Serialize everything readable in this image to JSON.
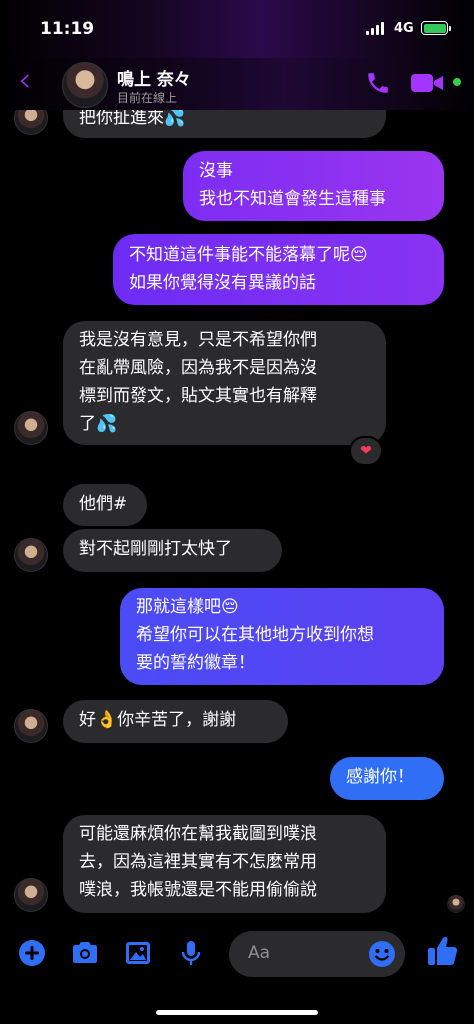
{
  "status_bar": {
    "time": "11:19",
    "network": "4G"
  },
  "header": {
    "back_icon": "‹",
    "contact_name": "鳴上 奈々",
    "presence": "目前在線上"
  },
  "colors": {
    "accent": "#a335ff",
    "in_bubble": "#2b2b2d",
    "online": "#31d14d"
  },
  "messages": [
    {
      "id": "m0",
      "dir": "in",
      "text": "把你扯進來💦"
    },
    {
      "id": "m1",
      "dir": "out",
      "text": "沒事\n我也不知道會發生這種事"
    },
    {
      "id": "m2",
      "dir": "out",
      "text": "不知道這件事能不能落幕了呢😔\n如果你覺得沒有異議的話"
    },
    {
      "id": "m3",
      "dir": "in",
      "text": "我是沒有意見，只是不希望你們\n在亂帶風險，因為我不是因為沒\n標到而發文，貼文其實也有解釋\n了💦",
      "reaction": "❤"
    },
    {
      "id": "m4",
      "dir": "in",
      "text": "他們#"
    },
    {
      "id": "m5",
      "dir": "in",
      "text": "對不起剛剛打太快了"
    },
    {
      "id": "m6",
      "dir": "out",
      "text": "那就這樣吧😔\n希望你可以在其他地方收到你想\n要的誓約徽章！"
    },
    {
      "id": "m7",
      "dir": "in",
      "text": "好👌你辛苦了，謝謝"
    },
    {
      "id": "m8",
      "dir": "out",
      "text": "感謝你！"
    },
    {
      "id": "m9",
      "dir": "in",
      "text": "可能還麻煩你在幫我截圖到噗浪\n去，因為這裡其實有不怎麼常用\n噗浪，我帳號還是不能用偷偷說"
    }
  ],
  "composer": {
    "placeholder": "Aa",
    "icons": [
      "plus-icon",
      "camera-icon",
      "image-icon",
      "microphone-icon",
      "emoji-icon",
      "thumbs-up-icon"
    ]
  }
}
